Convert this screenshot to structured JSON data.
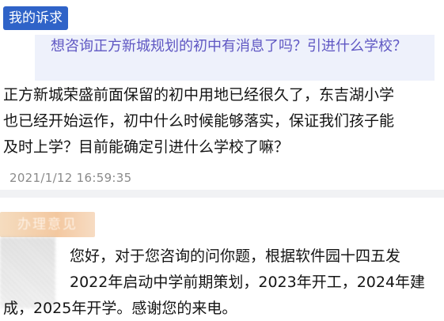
{
  "appeal": {
    "tag_label": "我的诉求",
    "question": "想咨询正方新城规划的初中有消息了吗？引进什么学校？",
    "body_lines": [
      "正方新城荣盛前面保留的初中用地已经很久了，东吉湖小学",
      "也已经开始运作，初中什么时候能够落实，保证我们孩子能",
      "及时上学？目前能确定引进什么学校了嘛？"
    ],
    "timestamp": "2021/1/12 16:59:35"
  },
  "reply": {
    "tag_label": "办理意见",
    "lines": [
      "您好，对于您咨询的问你题，根据软件园十四五发",
      "2022年启动中学前期策划，2023年开工，2024年建",
      "成，2025年开学。感谢您的来电。"
    ]
  },
  "colors": {
    "tag_blue": "#2f63c8",
    "question_text": "#5f57c3",
    "question_bg": "#eef1fb",
    "reply_tag": "#f3c8a0",
    "timestamp": "#8a8a8a"
  }
}
